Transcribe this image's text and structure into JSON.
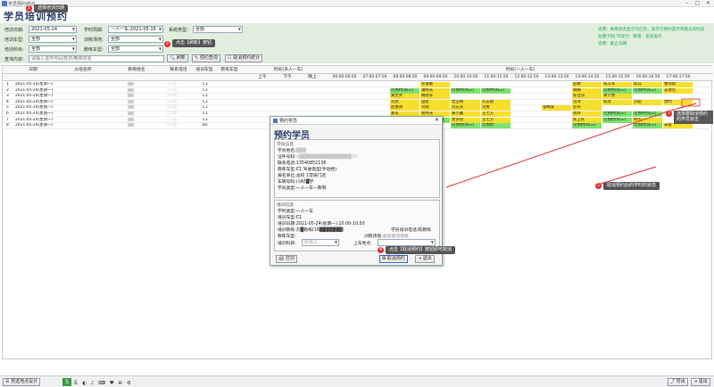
{
  "window": {
    "title": "学员预约培训",
    "minimize": "–",
    "maximize": "▢",
    "close": "✕"
  },
  "app_title": "学员培训预约",
  "filters": {
    "date_label": "培训日期:",
    "date_value": "2021-05-24",
    "cycle_label": "学时周期:",
    "cycle_value": "一人一车-2021-05-18",
    "system_label": "系统类型:",
    "system_value": "全部",
    "vehicle_label": "培训车型:",
    "vehicle_value": "全部",
    "site_label": "训练场地:",
    "site_value": "全部",
    "subject_label": "培训科目:",
    "subject_value": "全部",
    "coach_type_label": "教练车型:",
    "coach_type_value": "全部",
    "query_label": "查询内容:",
    "query_placeholder": "请输入证件号码/姓名/教练姓名",
    "refresh_btn": "刷新",
    "book_query_btn": "预约查询",
    "cancel_stat_btn": "取消预约统计",
    "note1": "说明：教练姓名显示为红色，表示可预约其代带教员的时段",
    "note2": "右键'时段'可进行：解锁、查询操作",
    "note3": "说明：截止日期"
  },
  "grid": {
    "headers": [
      "日期",
      "分组名称",
      "教练姓名",
      "联系电话",
      "培训车型",
      "教练车型",
      "时段(多人一车)",
      "时段(一人一车)"
    ],
    "sub_multi": [
      "上午",
      "下午",
      "晚上"
    ],
    "slots": [
      "06:00-06:50",
      "07:00-07:50",
      "08:00-08:50",
      "09:00-09:50",
      "10:00-10:50",
      "11:00-11:50",
      "12:00-12:50",
      "13:00-13:50",
      "14:00-14:50",
      "15:00-15:50",
      "16:00-16:50",
      "17:00-17:50"
    ],
    "rows": [
      {
        "no": "1",
        "date": "2021-05-24(星期一)",
        "coach": "▓▓",
        "phone": "1735",
        "type": "C1",
        "cells": [
          [
            "",
            "",
            "",
            "许慧敏",
            "",
            "",
            "",
            "",
            "彭敏",
            "朱方军",
            "陈兵",
            "曹雨明"
          ]
        ]
      },
      {
        "no": "2",
        "date": "2021-05-24(星期一)",
        "coach": "▓▓",
        "phone": "1735",
        "type": "C1",
        "cells": [
          [
            "",
            "",
            "可预约(科三)",
            "潘晓光",
            "可预约(科三)",
            "可预约(科三)",
            "",
            "",
            "韩静",
            "可预约(科三)",
            "可预约(科三)",
            "吴建佳"
          ]
        ]
      },
      {
        "no": "3",
        "date": "2021-05-24(星期一)",
        "coach": "▓▓",
        "phone": "1735",
        "type": "C1",
        "cells": [
          [
            "",
            "",
            "黄文英",
            "胡晓军",
            "",
            "",
            "",
            "",
            "陈佳琪",
            "黄学勇",
            "",
            ""
          ]
        ]
      },
      {
        "no": "4",
        "date": "2021-05-24(星期一)",
        "coach": "▓▓",
        "phone": "1735",
        "type": "C1",
        "cells": [
          [
            "",
            "",
            "刘英",
            "田智",
            "曾玉梅",
            "苏志斌",
            "",
            "",
            "范萍",
            "侯瑶",
            "苏超",
            "预约"
          ]
        ]
      },
      {
        "no": "5",
        "date": "2021-05-24(星期一)",
        "coach": "▓▓",
        "phone": "1735",
        "type": "C1",
        "cells": [
          [
            "",
            "",
            "赵健洲",
            "刘萌",
            "苏志光",
            "刘勇",
            "",
            "张梅发",
            "彭祥",
            "",
            "",
            ""
          ]
        ]
      },
      {
        "no": "6",
        "date": "2021-05-24(星期一)",
        "coach": "▓▓",
        "phone": "1735",
        "type": "C1",
        "cells": [
          [
            "",
            "",
            "郑军",
            "胡伟光",
            "黄小藏",
            "王七方",
            "",
            "",
            "周辉",
            "可预约(科三)",
            "可预约(科三)",
            ""
          ]
        ]
      },
      {
        "no": "7",
        "date": "2021-05-24(星期一)",
        "coach": "▓▓",
        "phone": "1735",
        "type": "C1",
        "cells": [
          [
            "",
            "",
            "可预约(科三)",
            "可预约(科三)",
            "更多组",
            "王七方",
            "",
            "",
            "陈卫民",
            "可预约(科三)",
            "韩杰",
            ""
          ]
        ]
      },
      {
        "no": "8",
        "date": "2021-05-24(星期一)",
        "coach": "▓▓",
        "phone": "1735",
        "type": "B2",
        "cells": [
          [
            "",
            "",
            "",
            "",
            "可预约(科三)",
            "可预约",
            "",
            "",
            "可预约(科三)",
            "",
            "可预约(科三)",
            "未留"
          ]
        ]
      }
    ]
  },
  "dialog": {
    "title": "预约学员",
    "header": "预约学员",
    "sec1_title": "学员信息",
    "student_name_label": "学员姓名:",
    "student_name": "▓▓▓",
    "id_label": "证件号码:",
    "id_value": "6▓▓▓▓▓▓▓▓▓▓▓▓▓▓▓▓36",
    "phone_label": "联系电话:",
    "phone_value": "13540852136",
    "car_label": "教练车型:",
    "car_value": "C1  驾驶类型(手动档)",
    "unit_label": "报名单位:",
    "unit_value": "总校  1营培门店",
    "reg_label": "学籍状态:",
    "reg_value": "",
    "coach_label": "车辆号码:",
    "coach_value": "川A5▓学",
    "type_label": "学员类型:",
    "type_value": "一人一车一教制",
    "sec2_title": "培训信息",
    "train_type_label": "学时类型:",
    "train_type_value": "一人一车",
    "train_vehicle_label": "培训车型:",
    "train_vehicle_value": "C1",
    "train_date_label": "培训日期:",
    "train_date_value": "2021-05-24(星期一) 10:00-10:50",
    "train_coach_label": "培训教练:",
    "train_coach_value": "刘▓教练(18▓▓▓▓▓▓▓)",
    "phone2_label": "学员培训电话:",
    "phone2_value": "陈教练",
    "car2_label": "教练车型:",
    "site_label": "训练场地:",
    "site_value": "总校培训场地",
    "subject_label": "培训科目:",
    "subject_value": "科目三",
    "pickup_label": "上车地点:",
    "print_btn": "打印",
    "cancel_book_btn": "取消预约",
    "exit_btn": "退出"
  },
  "annotations": {
    "a1": "选择培训日期",
    "a2": "点击【刷新】按钮",
    "a3": "选择要取消预约的学员双击",
    "a4": "点击【取消预约】按钮即可取消",
    "a5": "取消预约后的学时的状态",
    "b1": "1",
    "b2": "2",
    "b3": "3",
    "b4": "4",
    "b5": "5"
  },
  "footer": {
    "location_btn": "预选地点设计",
    "export_btn": "导出",
    "exit_btn": "退出"
  },
  "colors": {
    "booked": "#f7df2f",
    "available": "#7fe26f",
    "panel": "#dfeedd"
  }
}
